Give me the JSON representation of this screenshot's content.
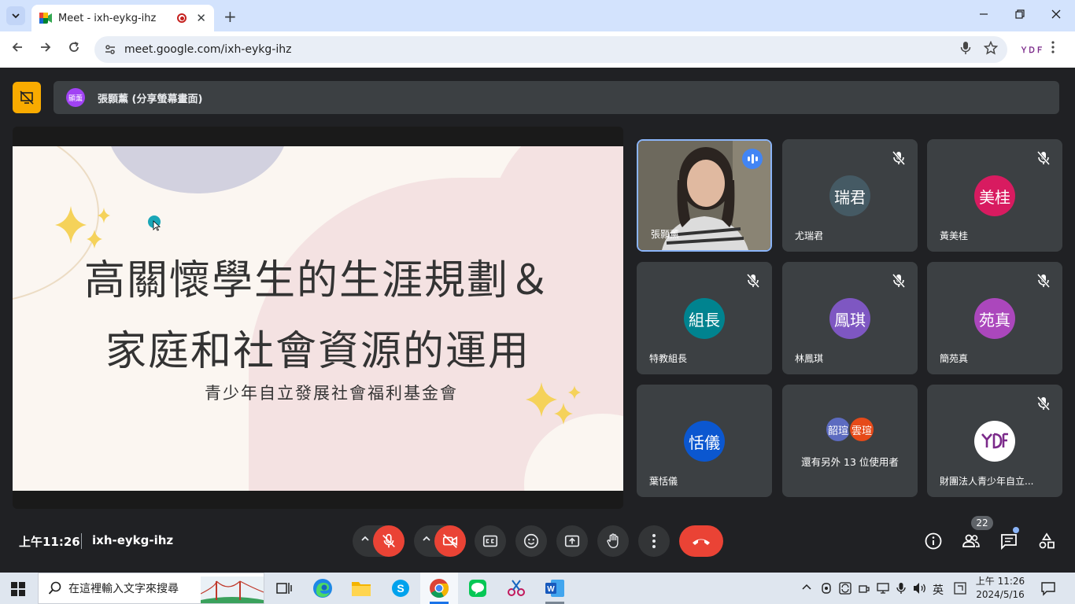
{
  "browser": {
    "tab_title": "Meet - ixh-eykg-ihz",
    "tab_close": "✕",
    "new_tab": "+",
    "url": "meet.google.com/ixh-eykg-ihz",
    "extension_label": "ＹＤＦ"
  },
  "meet": {
    "presenter_avatar": "顯薰",
    "presenter_text": "張顥薰 (分享螢幕畫面)",
    "slide": {
      "title_line1": "高關懷學生的生涯規劃＆",
      "title_line2": "家庭和社會資源的運用",
      "subtitle": "青少年自立發展社會福利基金會"
    },
    "participants": [
      {
        "name": "張顥薰",
        "video": true,
        "speaking": true
      },
      {
        "name": "尤瑞君",
        "avatar": "瑞君",
        "color": "#455a64"
      },
      {
        "name": "黃美桂",
        "avatar": "美桂",
        "color": "#d81b60"
      },
      {
        "name": "特教組長",
        "avatar": "組長",
        "color": "#00838f"
      },
      {
        "name": "林鳳琪",
        "avatar": "鳳琪",
        "color": "#7e57c2"
      },
      {
        "name": "簡苑真",
        "avatar": "苑真",
        "color": "#ab47bc"
      },
      {
        "name": "葉恬儀",
        "avatar": "恬儀",
        "color": "#0b57d0"
      },
      {
        "name": "財團法人青少年自立...",
        "avatar": "logo"
      }
    ],
    "more_tile": {
      "avatar1": "韶瑄",
      "avatar1_color": "#5c6bc0",
      "avatar2": "雲瑄",
      "avatar2_color": "#e64a19",
      "text": "還有另外 13 位使用者"
    },
    "time": "上午11:26",
    "meeting_code": "ixh-eykg-ihz",
    "people_count": "22"
  },
  "taskbar": {
    "search_placeholder": "在這裡輸入文字來搜尋",
    "ime": "英",
    "clock_time": "上午 11:26",
    "clock_date": "2024/5/16"
  }
}
